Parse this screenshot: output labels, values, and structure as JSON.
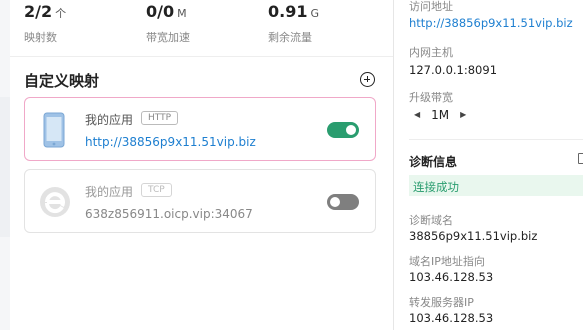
{
  "stats": [
    {
      "value": "2/2",
      "unit": "个",
      "label": "映射数"
    },
    {
      "value": "0/0",
      "unit": "M",
      "label": "带宽加速"
    },
    {
      "value": "0.91",
      "unit": "G",
      "label": "剩余流量"
    }
  ],
  "section": {
    "title": "自定义映射"
  },
  "mappings": [
    {
      "name": "我的应用",
      "protocol": "HTTP",
      "address": "http://38856p9x11.51vip.biz",
      "enabled": true
    },
    {
      "name": "我的应用",
      "protocol": "TCP",
      "address": "638z856911.oicp.vip:34067",
      "enabled": false
    }
  ],
  "details": {
    "access_label": "访问地址",
    "access_url": "http://38856p9x11.51vip.biz",
    "host_label": "内网主机",
    "host_value": "127.0.0.1:8091",
    "bandwidth_label": "升级带宽",
    "bandwidth_value": "1M"
  },
  "diagnosis": {
    "title": "诊断信息",
    "status": "连接成功",
    "domain_label": "诊断域名",
    "domain_value": "38856p9x11.51vip.biz",
    "ip_label": "域名IP地址指向",
    "ip_value": "103.46.128.53",
    "server_label": "转发服务器IP",
    "server_value": "103.46.128.53"
  },
  "colors": {
    "accent_green": "#2a9d6f",
    "link_blue": "#1e7fd0",
    "card_active_border": "#f0a8c8"
  }
}
